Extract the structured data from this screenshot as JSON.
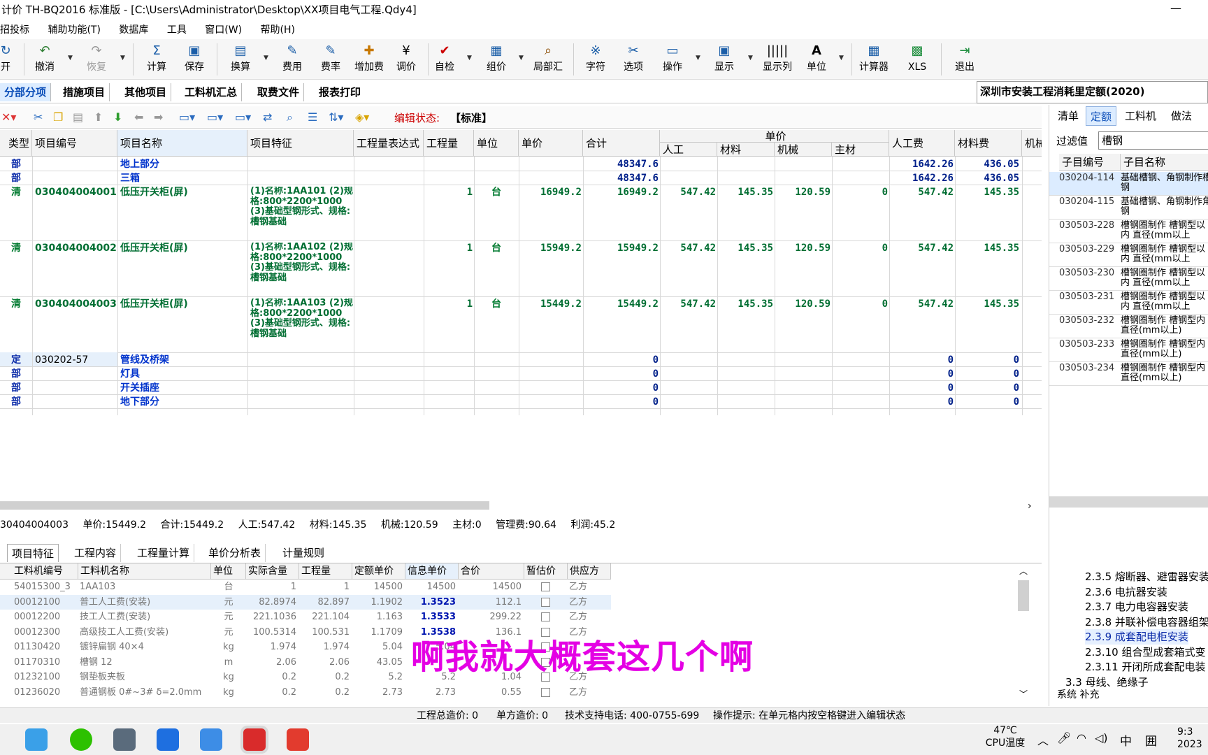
{
  "window": {
    "title": "计价 TH-BQ2016 标准版 - [C:\\Users\\Administrator\\Desktop\\XX项目电气工程.Qdy4]",
    "minimize": "—"
  },
  "menu": [
    "招投标",
    "辅助功能(T)",
    "数据库",
    "工具",
    "窗口(W)",
    "帮助(H)"
  ],
  "toolbar": {
    "items": [
      {
        "label": "开",
        "icon": "open-icon"
      },
      {
        "label": "撤消",
        "icon": "undo-icon"
      },
      {
        "label": "恢复",
        "icon": "redo-icon"
      },
      {
        "label": "计算",
        "icon": "sigma-icon"
      },
      {
        "label": "保存",
        "icon": "save-icon"
      },
      {
        "label": "换算",
        "icon": "convert-icon"
      },
      {
        "label": "费用",
        "icon": "fee-icon"
      },
      {
        "label": "费率",
        "icon": "rate-icon"
      },
      {
        "label": "增加费",
        "icon": "add-fee-icon"
      },
      {
        "label": "调价",
        "icon": "yen-icon"
      },
      {
        "label": "自检",
        "icon": "check-icon"
      },
      {
        "label": "组价",
        "icon": "group-price-icon"
      },
      {
        "label": "局部汇",
        "icon": "local-sum-icon"
      },
      {
        "label": "字符",
        "icon": "char-icon"
      },
      {
        "label": "选项",
        "icon": "options-icon"
      },
      {
        "label": "操作",
        "icon": "operate-icon"
      },
      {
        "label": "显示",
        "icon": "display-icon"
      },
      {
        "label": "显示列",
        "icon": "columns-icon"
      },
      {
        "label": "单位",
        "icon": "unit-icon"
      },
      {
        "label": "计算器",
        "icon": "calculator-icon"
      },
      {
        "label": "XLS",
        "icon": "xls-icon"
      },
      {
        "label": "退出",
        "icon": "exit-icon"
      }
    ]
  },
  "main_tabs": [
    "分部分项",
    "措施项目",
    "其他项目",
    "工料机汇总",
    "取费文件",
    "报表打印"
  ],
  "quota_standard": "深圳市安装工程消耗里定额(2020)",
  "edit_state": {
    "label": "编辑状态:",
    "value": "【标准】"
  },
  "grid": {
    "headers": {
      "type": "类型",
      "code": "项目编号",
      "name": "项目名称",
      "feature": "项目特征",
      "expr": "工程量表达式",
      "qty": "工程量",
      "unit": "单位",
      "price": "单价",
      "total": "合计",
      "unit_price_group": "单价",
      "labor": "人工",
      "material": "材料",
      "machine": "机械",
      "main_mat": "主材",
      "labor_fee": "人工费",
      "material_fee": "材料费",
      "machine_fee": "机械"
    },
    "rows": [
      {
        "type": "部",
        "code": "",
        "name": "地上部分",
        "feature": "",
        "qty": "",
        "unit": "",
        "price": "",
        "total": "48347.6",
        "labor": "",
        "material": "",
        "machine": "",
        "main": "",
        "labor_fee": "1642.26",
        "material_fee": "436.05"
      },
      {
        "type": "部",
        "code": "",
        "name": "三箱",
        "feature": "",
        "qty": "",
        "unit": "",
        "price": "",
        "total": "48347.6",
        "labor": "",
        "material": "",
        "machine": "",
        "main": "",
        "labor_fee": "1642.26",
        "material_fee": "436.05"
      },
      {
        "type": "清",
        "code": "030404004001",
        "name": "低压开关柜(屏)",
        "feature": "(1)名称:1AA101\n(2)规格:800*2200*1000\n(3)基础型钢形式、规格:槽钢基础",
        "qty": "1",
        "unit": "台",
        "price": "16949.2",
        "total": "16949.2",
        "labor": "547.42",
        "material": "145.35",
        "machine": "120.59",
        "main": "0",
        "labor_fee": "547.42",
        "material_fee": "145.35"
      },
      {
        "type": "清",
        "code": "030404004002",
        "name": "低压开关柜(屏)",
        "feature": "(1)名称:1AA102\n(2)规格:800*2200*1000\n(3)基础型钢形式、规格:槽钢基础",
        "qty": "1",
        "unit": "台",
        "price": "15949.2",
        "total": "15949.2",
        "labor": "547.42",
        "material": "145.35",
        "machine": "120.59",
        "main": "0",
        "labor_fee": "547.42",
        "material_fee": "145.35"
      },
      {
        "type": "清",
        "code": "030404004003",
        "name": "低压开关柜(屏)",
        "feature": "(1)名称:1AA103\n(2)规格:800*2200*1000\n(3)基础型钢形式、规格:槽钢基础",
        "qty": "1",
        "unit": "台",
        "price": "15449.2",
        "total": "15449.2",
        "labor": "547.42",
        "material": "145.35",
        "machine": "120.59",
        "main": "0",
        "labor_fee": "547.42",
        "material_fee": "145.35"
      },
      {
        "type": "定",
        "code": "030202-57",
        "name": "管线及桥架",
        "feature": "",
        "qty": "",
        "unit": "",
        "price": "",
        "total": "0",
        "labor": "",
        "material": "",
        "machine": "",
        "main": "",
        "labor_fee": "0",
        "material_fee": "0"
      },
      {
        "type": "部",
        "code": "",
        "name": "灯具",
        "feature": "",
        "qty": "",
        "unit": "",
        "price": "",
        "total": "0",
        "labor": "",
        "material": "",
        "machine": "",
        "main": "",
        "labor_fee": "0",
        "material_fee": "0"
      },
      {
        "type": "部",
        "code": "",
        "name": "开关插座",
        "feature": "",
        "qty": "",
        "unit": "",
        "price": "",
        "total": "0",
        "labor": "",
        "material": "",
        "machine": "",
        "main": "",
        "labor_fee": "0",
        "material_fee": "0"
      },
      {
        "type": "部",
        "code": "",
        "name": "地下部分",
        "feature": "",
        "qty": "",
        "unit": "",
        "price": "",
        "total": "0",
        "labor": "",
        "material": "",
        "machine": "",
        "main": "",
        "labor_fee": "0",
        "material_fee": "0"
      }
    ]
  },
  "summary": {
    "code": "30404004003",
    "price": "单价:15449.2",
    "total": "合计:15449.2",
    "labor": "人工:547.42",
    "material": "材料:145.35",
    "machine": "机械:120.59",
    "main": "主材:0",
    "mgmt": "管理费:90.64",
    "profit": "利润:45.2"
  },
  "bottom_tabs": [
    "项目特征",
    "工程内容",
    "工程量计算",
    "单价分析表",
    "计量规则"
  ],
  "bottom_grid": {
    "headers": [
      "工料机编号",
      "工料机名称",
      "单位",
      "实际含量",
      "工程量",
      "定额单价",
      "信息单价",
      "合价",
      "暂估价",
      "供应方"
    ],
    "rows": [
      {
        "code": "54015300_3",
        "name": "1AA103",
        "unit": "台",
        "content": "1",
        "qty": "1",
        "quota": "14500",
        "info": "14500",
        "sum": "14500",
        "supplier": "乙方"
      },
      {
        "code": "00012100",
        "name": "普工人工费(安装)",
        "unit": "元",
        "content": "82.8974",
        "qty": "82.897",
        "quota": "1.1902",
        "info": "1.3523",
        "sum": "112.1",
        "supplier": "乙方"
      },
      {
        "code": "00012200",
        "name": "技工人工费(安装)",
        "unit": "元",
        "content": "221.1036",
        "qty": "221.104",
        "quota": "1.163",
        "info": "1.3533",
        "sum": "299.22",
        "supplier": "乙方"
      },
      {
        "code": "00012300",
        "name": "高级技工人工费(安装)",
        "unit": "元",
        "content": "100.5314",
        "qty": "100.531",
        "quota": "1.1709",
        "info": "1.3538",
        "sum": "136.1",
        "supplier": "乙方"
      },
      {
        "code": "01130420",
        "name": "镀锌扁钢 40×4",
        "unit": "kg",
        "content": "1.974",
        "qty": "1.974",
        "quota": "5.04",
        "info": "5.04",
        "sum": "",
        "supplier": ""
      },
      {
        "code": "01170310",
        "name": "槽钢 12",
        "unit": "m",
        "content": "2.06",
        "qty": "2.06",
        "quota": "43.05",
        "info": "",
        "sum": "",
        "supplier": ""
      },
      {
        "code": "01232100",
        "name": "钢垫板夹板",
        "unit": "kg",
        "content": "0.2",
        "qty": "0.2",
        "quota": "5.2",
        "info": "5.2",
        "sum": "1.04",
        "supplier": "乙方"
      },
      {
        "code": "01236020",
        "name": "普通钢板 0#~3# δ=2.0mm",
        "unit": "kg",
        "content": "0.2",
        "qty": "0.2",
        "quota": "2.73",
        "info": "2.73",
        "sum": "0.55",
        "supplier": "乙方"
      }
    ]
  },
  "subtitle": "啊我就大概套这几个啊",
  "right_panel": {
    "tabs": [
      "清单",
      "定额",
      "工料机",
      "做法"
    ],
    "filter_label": "过滤值",
    "filter_value": "槽钢",
    "headers": [
      "子目编号",
      "子目名称"
    ],
    "rows": [
      {
        "code": "030204-114",
        "name": "基础槽钢、角钢制作槽钢"
      },
      {
        "code": "030204-115",
        "name": "基础槽钢、角钢制作角钢"
      },
      {
        "code": "030503-228",
        "name": "槽钢圈制作 槽钢型以内 直径(mm以上"
      },
      {
        "code": "030503-229",
        "name": "槽钢圈制作 槽钢型以内 直径(mm以上"
      },
      {
        "code": "030503-230",
        "name": "槽钢圈制作 槽钢型以内 直径(mm以上"
      },
      {
        "code": "030503-231",
        "name": "槽钢圈制作 槽钢型以内 直径(mm以上"
      },
      {
        "code": "030503-232",
        "name": "槽钢圈制作 槽钢型内 直径(mm以上)"
      },
      {
        "code": "030503-233",
        "name": "槽钢圈制作 槽钢型内 直径(mm以上)"
      },
      {
        "code": "030503-234",
        "name": "槽钢圈制作 槽钢型内 直径(mm以上)"
      }
    ],
    "tree": [
      "2.3.5 熔断器、避雷器安装",
      "2.3.6 电抗器安装",
      "2.3.7 电力电容器安装",
      "2.3.8 并联补偿电容器组架",
      "2.3.9 成套配电柜安装",
      "2.3.10 组合型成套箱式变",
      "2.3.11 开闭所成套配电装",
      "3.3 母线、绝缘子"
    ],
    "bottom_tabs": "系统 补充"
  },
  "statusbar": {
    "total_cost": "工程总造价: 0",
    "unit_cost": "单方造价: 0",
    "support": "技术支持电话: 400-0755-699",
    "hint": "操作提示: 在单元格内按空格键进入编辑状态"
  },
  "taskbar": {
    "temp": "47℃",
    "cpu": "CPU温度",
    "ime": "中",
    "time": "9:3",
    "date": "2023"
  }
}
